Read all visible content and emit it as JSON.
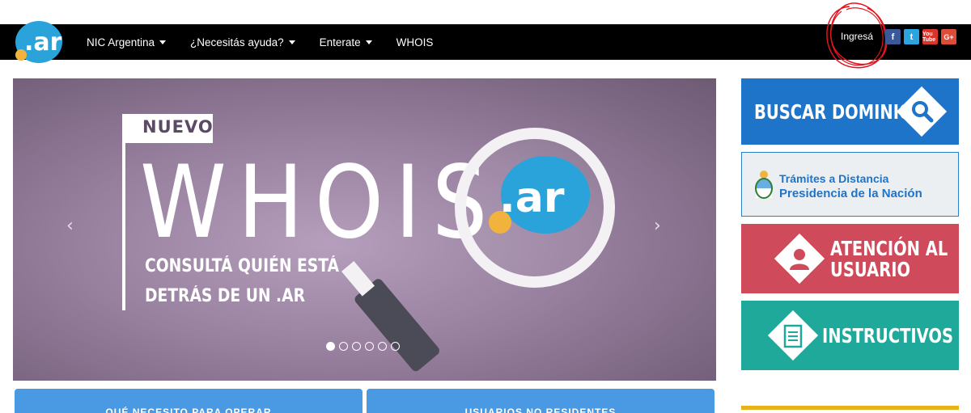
{
  "header": {
    "logo_text": ".ar",
    "nav": [
      {
        "label": "NIC Argentina",
        "has_caret": true
      },
      {
        "label": "¿Necesitás ayuda?",
        "has_caret": true
      },
      {
        "label": "Enterate",
        "has_caret": true
      },
      {
        "label": "WHOIS",
        "has_caret": false
      }
    ],
    "login_label": "Ingresá",
    "social": [
      {
        "name": "facebook-icon",
        "glyph": "f"
      },
      {
        "name": "twitter-icon",
        "glyph": "t"
      },
      {
        "name": "youtube-icon",
        "glyph": "You Tube"
      },
      {
        "name": "google-plus-icon",
        "glyph": "G+"
      }
    ]
  },
  "carousel": {
    "slide_badge": "NUEVO",
    "slide_title": "WHOIS",
    "slide_sub_1": "CONSULTÁ QUIÉN ESTÁ",
    "slide_sub_2": "DETRÁS DE UN .AR",
    "logo_text": ".ar",
    "prev": "‹",
    "next": "›",
    "dots_count": 6,
    "active_dot": 0
  },
  "sidebar": {
    "buscar": "BUSCAR DOMINIOS",
    "tramites_1": "Trámites a Distancia",
    "tramites_2": "Presidencia de la Nación",
    "atencion_1": "ATENCIÓN AL",
    "atencion_2": "USUARIO",
    "instructivos": "INSTRUCTIVOS"
  },
  "tiles": {
    "a": "QUÉ NECESITO PARA OPERAR",
    "b": "USUARIOS NO RESIDENTES"
  },
  "colors": {
    "nav_bg": "#000000",
    "buscar": "#1e74c9",
    "atencion": "#cf4a5a",
    "instructivos": "#1fa99a",
    "tile": "#4a9ae3",
    "brand_blue": "#29a3d9"
  }
}
